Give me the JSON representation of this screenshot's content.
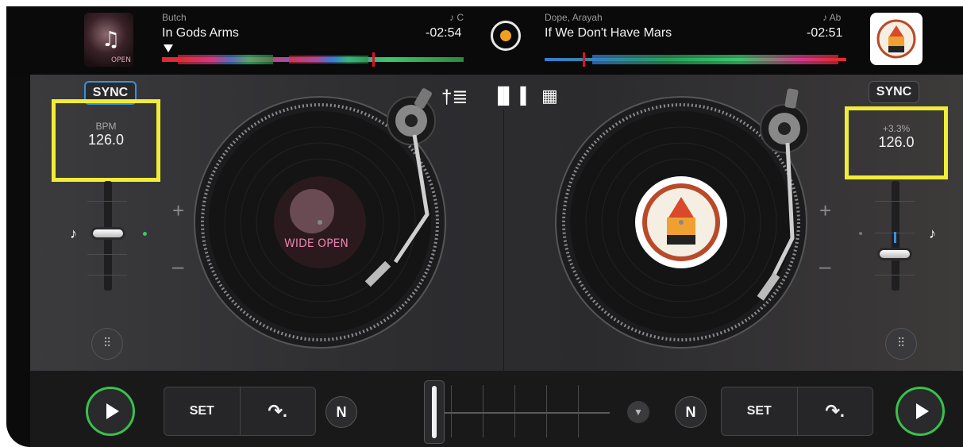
{
  "deckA": {
    "artist": "Butch",
    "title": "In Gods Arms",
    "time": "-02:54",
    "key": "♪ C",
    "sync": "SYNC",
    "bpm_label": "BPM",
    "bpm_value": "126.0",
    "plus": "+",
    "minus": "–",
    "cover_text": "WIDE OPEN"
  },
  "deckB": {
    "artist": "Dope, Arayah",
    "title": "If We Don't Have Mars",
    "time": "-02:51",
    "key": "♪ Ab",
    "sync": "SYNC",
    "bpm_label": "+3.3%",
    "bpm_value": "126.0",
    "plus": "+",
    "minus": "–"
  },
  "transport": {
    "set_label_a": "SET",
    "set_label_b": "SET",
    "n_label": "N"
  },
  "icons": {
    "record": "record-icon",
    "fx": "equalizer-icon",
    "waveform": "waveform-icon",
    "grid": "grid-icon",
    "loop": "loop-arrow-icon",
    "play": "play-icon"
  },
  "colors": {
    "highlight": "#f1ec3a",
    "play_ring": "#37c24a",
    "sync_active": "#3a8fd8",
    "playhead": "#e0102a"
  }
}
